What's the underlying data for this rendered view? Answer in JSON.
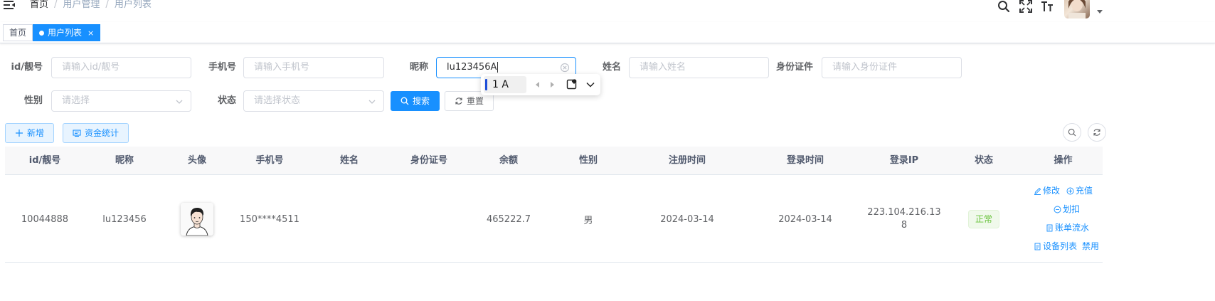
{
  "breadcrumb": [
    "首页",
    "用户管理",
    "用户列表"
  ],
  "tags": [
    {
      "label": "首页"
    },
    {
      "label": "用户列表",
      "close": "×"
    }
  ],
  "form": {
    "id_label": "id/靓号",
    "id_placeholder": "请输入id/靓号",
    "phone_label": "手机号",
    "phone_placeholder": "请输入手机号",
    "nick_label": "昵称",
    "nick_value": "lu123456A",
    "name_label": "姓名",
    "name_placeholder": "请输入姓名",
    "idcard_label": "身份证件",
    "idcard_placeholder": "请输入身份证件",
    "gender_label": "性别",
    "gender_placeholder": "请选择",
    "status_label": "状态",
    "status_placeholder": "请选择状态",
    "search_label": "搜索",
    "reset_label": "重置"
  },
  "ime": {
    "candidate": "1 A"
  },
  "toolbar": {
    "add_label": "新增",
    "funds_label": "资金统计"
  },
  "table": {
    "headers": [
      "id/靓号",
      "昵称",
      "头像",
      "手机号",
      "姓名",
      "身份证号",
      "余额",
      "性别",
      "注册时间",
      "登录时间",
      "登录IP",
      "状态",
      "操作"
    ],
    "rows": [
      {
        "id": "10044888",
        "nickname": "lu123456",
        "phone": "150****4511",
        "name": "",
        "idcard": "",
        "balance": "465222.7",
        "gender": "男",
        "register_time": "2024-03-14",
        "login_time": "2024-03-14",
        "login_ip_line1": "223.104.216.13",
        "login_ip_line2": "8",
        "status": "正常",
        "ops": {
          "edit": "修改",
          "recharge": "充值",
          "deduct": "划扣",
          "bill": "账单流水",
          "devices": "设备列表",
          "disable": "禁用"
        }
      }
    ]
  },
  "colors": {
    "primary": "#1890ff",
    "success": "#67c23a"
  }
}
